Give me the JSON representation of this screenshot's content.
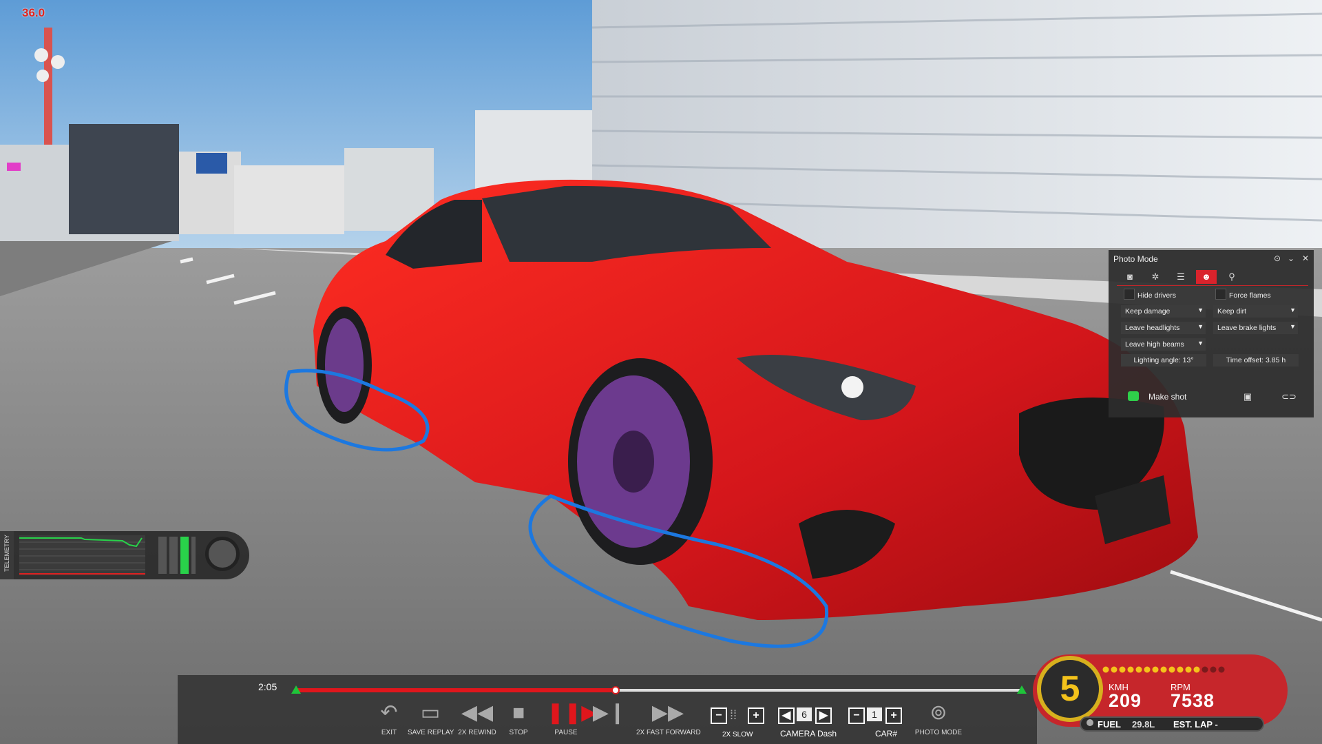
{
  "fps": "36.0",
  "photo_mode": {
    "title": "Photo Mode",
    "tabs": [
      "camera-icon",
      "aperture-icon",
      "sliders-icon",
      "people-icon",
      "map-pin-icon"
    ],
    "active_tab": 3,
    "hide_drivers": "Hide drivers",
    "force_flames": "Force flames",
    "keep_damage": "Keep damage",
    "keep_dirt": "Keep dirt",
    "leave_headlights": "Leave headlights",
    "leave_brake_lights": "Leave brake lights",
    "leave_high_beams": "Leave high beams",
    "lighting_angle": "Lighting angle: 13°",
    "time_offset": "Time offset: 3.85 h",
    "make_shot": "Make shot"
  },
  "telemetry": {
    "label": "TELEMETRY"
  },
  "replay": {
    "time": "2:05",
    "progress": 0.44,
    "exit": "EXIT",
    "save_replay": "SAVE REPLAY",
    "rewind": "2X REWIND",
    "stop": "STOP",
    "pause": "PAUSE",
    "fast_forward": "2X FAST FORWARD",
    "slow": "2X SLOW",
    "camera_value": "6",
    "camera_label": "CAMERA Dash",
    "car_value": "1",
    "car_label": "CAR#",
    "photo_mode": "PHOTO MODE"
  },
  "dash": {
    "gear": "5",
    "speed_unit": "KMH",
    "speed": "209",
    "rpm_unit": "RPM",
    "rpm": "7538",
    "fuel_label": "FUEL",
    "fuel": "29.8L",
    "est_lap": "EST. LAP -",
    "rev_lights_on": 12,
    "rev_lights_total": 15
  },
  "colors": {
    "car": "#d4161b",
    "accent": "#d9232c",
    "annotation": "#1c78e0"
  }
}
